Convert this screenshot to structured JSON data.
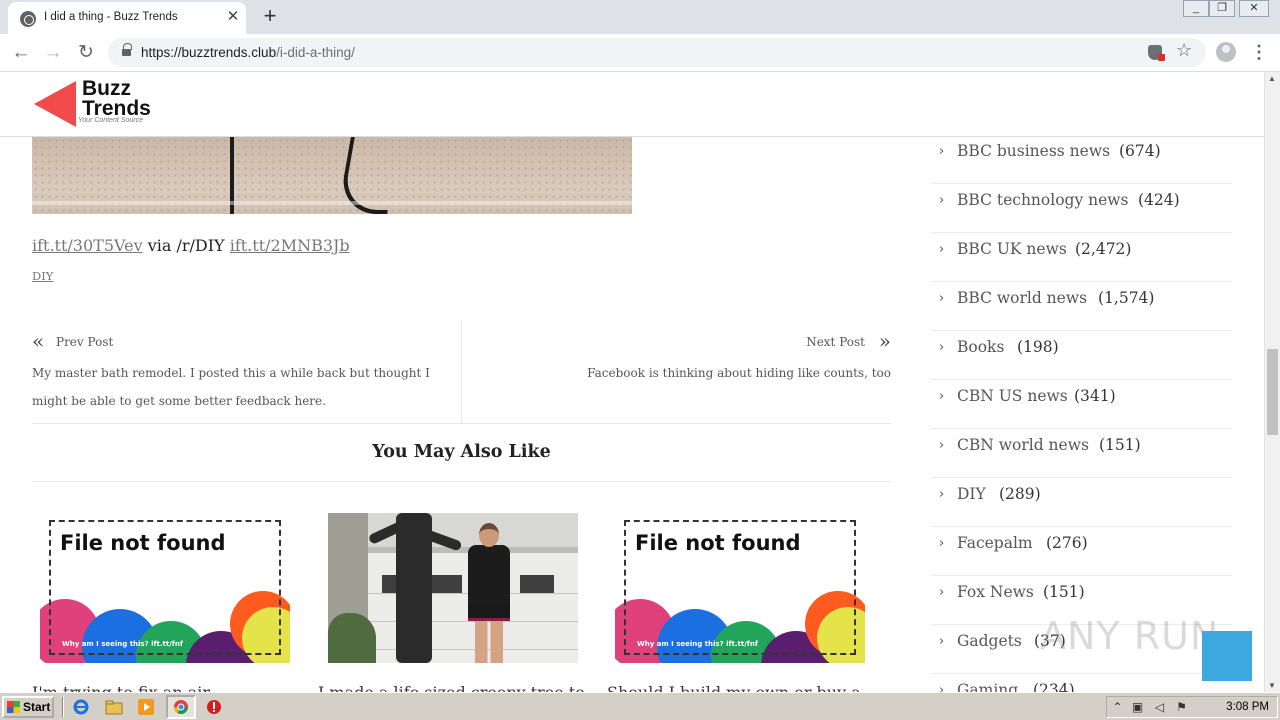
{
  "browser": {
    "tab_title": "I did a thing - Buzz Trends",
    "url_domain": "https://buzztrends.club",
    "url_path": "/i-did-a-thing/"
  },
  "site": {
    "logo_line1": "Buzz",
    "logo_line2": "Trends",
    "logo_tagline": "Your Content Source"
  },
  "post": {
    "source_link1": "ift.tt/30T5Vev",
    "source_via": " via /r/DIY ",
    "source_link2": "ift.tt/2MNB3Jb",
    "category": "DIY"
  },
  "post_nav": {
    "prev_label": "Prev Post",
    "prev_title": "My master bath remodel. I posted this a while back but thought I might be able to get some better feedback here.",
    "next_label": "Next Post",
    "next_title": "Facebook is thinking about hiding like counts, too"
  },
  "related": {
    "heading": "You May Also Like",
    "not_found_title": "File not found",
    "not_found_caption": "Why am I seeing this? ift.tt/fnf",
    "cards": [
      {
        "title": "I'm trying to fix an air"
      },
      {
        "title": "I made a life sized creepy tree to"
      },
      {
        "title": "Should I build my own or buy a"
      }
    ]
  },
  "sidebar": {
    "categories": [
      {
        "name": "BBC business news",
        "count": "(674)"
      },
      {
        "name": "BBC technology news",
        "count": "(424)"
      },
      {
        "name": "BBC UK news",
        "count": "(2,472)"
      },
      {
        "name": "BBC world news",
        "count": "(1,574)"
      },
      {
        "name": "Books",
        "count": "(198)"
      },
      {
        "name": "CBN US news",
        "count": "(341)"
      },
      {
        "name": "CBN world news",
        "count": "(151)"
      },
      {
        "name": "DIY",
        "count": "(289)"
      },
      {
        "name": "Facepalm",
        "count": "(276)"
      },
      {
        "name": "Fox News",
        "count": "(151)"
      },
      {
        "name": "Gadgets",
        "count": "(37)"
      },
      {
        "name": "Gaming",
        "count": "(234)"
      }
    ]
  },
  "watermark": "ANY RUN",
  "taskbar": {
    "start_label": "Start",
    "clock": "3:08 PM"
  },
  "colors": {
    "logo_red": "#f04a4a",
    "back_to_top": "#3da7e0"
  }
}
